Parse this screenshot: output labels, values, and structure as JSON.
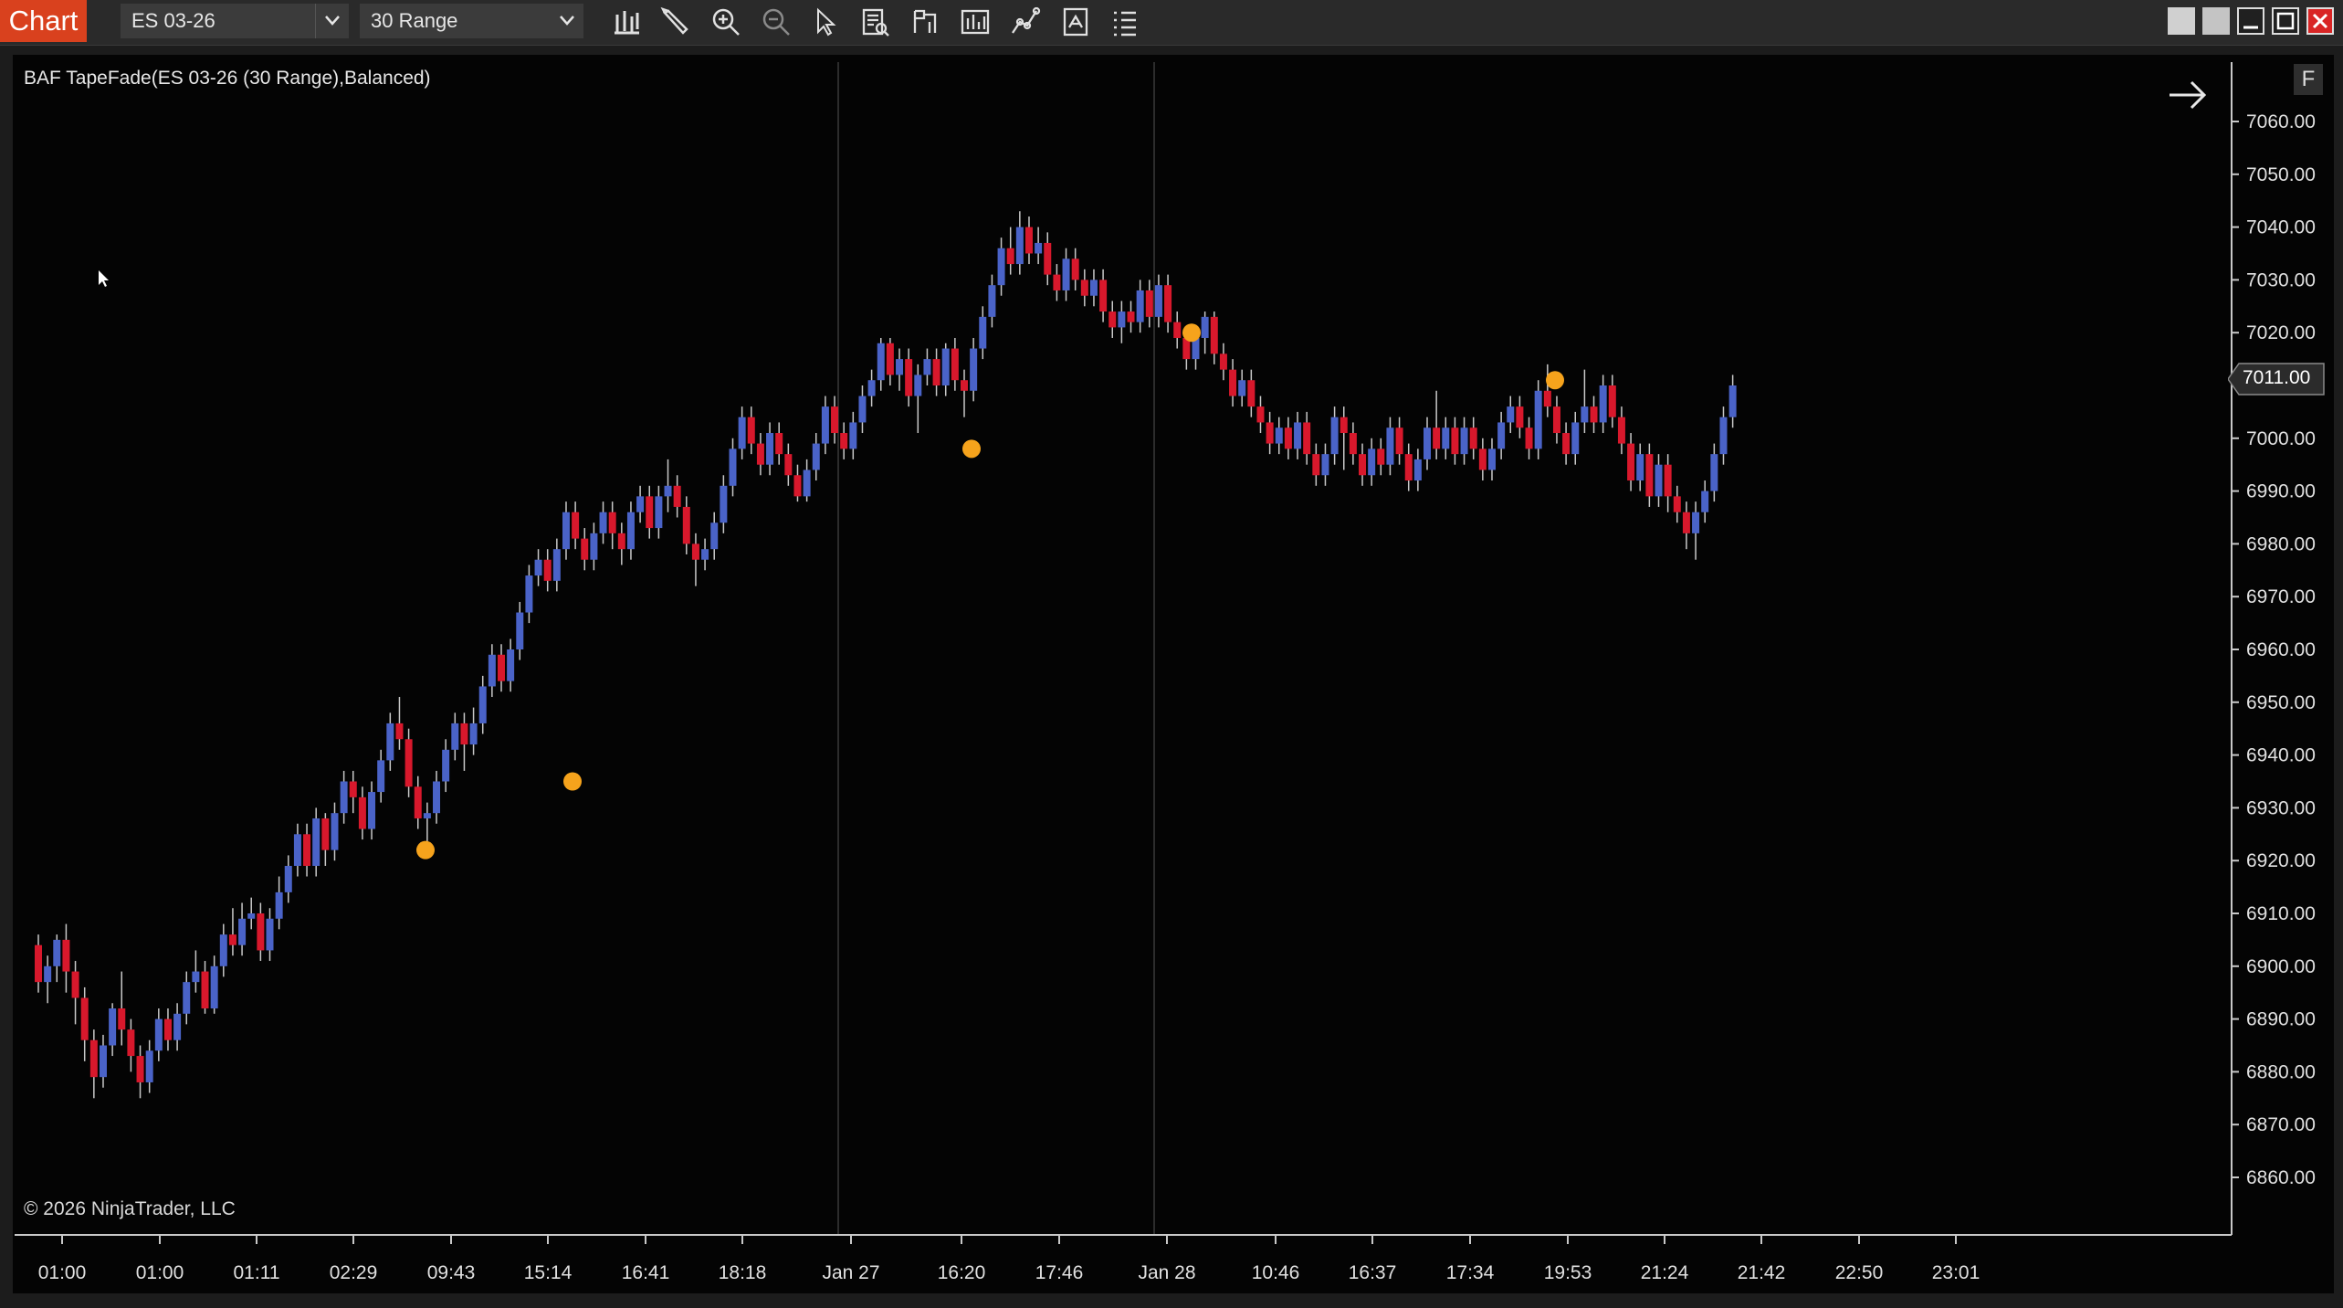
{
  "toolbar": {
    "app_tab": "Chart",
    "instrument": "ES 03-26",
    "interval": "30 Range",
    "tools": [
      {
        "name": "bar-type-icon"
      },
      {
        "name": "drawing-tools-icon"
      },
      {
        "name": "zoom-in-icon"
      },
      {
        "name": "zoom-out-icon"
      },
      {
        "name": "cursor-icon"
      },
      {
        "name": "data-box-icon"
      },
      {
        "name": "chart-trader-icon"
      },
      {
        "name": "indicators-icon"
      },
      {
        "name": "strategies-icon"
      },
      {
        "name": "properties-icon"
      },
      {
        "name": "list-icon"
      }
    ]
  },
  "chart": {
    "legend_title": "BAF TapeFade(ES 03-26 (30 Range),Balanced)",
    "copyright": "© 2026 NinjaTrader, LLC",
    "f_button": "F",
    "current_price_label": "7011.00",
    "colors": {
      "up": "#4a63c8",
      "down": "#d8182c",
      "signal": "#f6a31c",
      "background": "#040404"
    }
  },
  "chart_data": {
    "type": "candlestick",
    "title": "BAF TapeFade(ES 03-26 (30 Range),Balanced)",
    "y_ticks": [
      "7060.00",
      "7050.00",
      "7040.00",
      "7030.00",
      "7020.00",
      "7010.00",
      "7000.00",
      "6990.00",
      "6980.00",
      "6970.00",
      "6960.00",
      "6950.00",
      "6940.00",
      "6930.00",
      "6920.00",
      "6910.00",
      "6900.00",
      "6890.00",
      "6880.00",
      "6870.00",
      "6860.00"
    ],
    "x_ticks": [
      "01:00",
      "01:00",
      "01:11",
      "02:29",
      "09:43",
      "15:14",
      "16:41",
      "18:18",
      "Jan 27",
      "16:20",
      "17:46",
      "Jan 28",
      "10:46",
      "16:37",
      "17:34",
      "19:53",
      "21:24",
      "21:42",
      "22:50",
      "23:01"
    ],
    "ylim": [
      6855,
      7066
    ],
    "last_price": 7011.0,
    "bars": [
      [
        6904,
        6897,
        6906,
        6895
      ],
      [
        6897,
        6900,
        6902,
        6893
      ],
      [
        6900,
        6905,
        6906,
        6897
      ],
      [
        6905,
        6899,
        6908,
        6895
      ],
      [
        6899,
        6894,
        6901,
        6889
      ],
      [
        6894,
        6886,
        6896,
        6882
      ],
      [
        6886,
        6879,
        6888,
        6875
      ],
      [
        6879,
        6885,
        6887,
        6877
      ],
      [
        6885,
        6892,
        6893,
        6883
      ],
      [
        6892,
        6888,
        6899,
        6885
      ],
      [
        6888,
        6883,
        6890,
        6880
      ],
      [
        6883,
        6878,
        6885,
        6875
      ],
      [
        6878,
        6884,
        6886,
        6876
      ],
      [
        6884,
        6890,
        6892,
        6882
      ],
      [
        6890,
        6886,
        6892,
        6884
      ],
      [
        6886,
        6891,
        6893,
        6884
      ],
      [
        6891,
        6897,
        6899,
        6889
      ],
      [
        6897,
        6899,
        6903,
        6895
      ],
      [
        6899,
        6892,
        6901,
        6891
      ],
      [
        6892,
        6900,
        6902,
        6891
      ],
      [
        6900,
        6906,
        6908,
        6898
      ],
      [
        6906,
        6904,
        6911,
        6902
      ],
      [
        6904,
        6909,
        6912,
        6902
      ],
      [
        6909,
        6910,
        6913,
        6907
      ],
      [
        6910,
        6903,
        6912,
        6901
      ],
      [
        6903,
        6909,
        6911,
        6901
      ],
      [
        6909,
        6914,
        6917,
        6907
      ],
      [
        6914,
        6919,
        6921,
        6912
      ],
      [
        6919,
        6925,
        6927,
        6917
      ],
      [
        6925,
        6919,
        6927,
        6917
      ],
      [
        6919,
        6928,
        6930,
        6917
      ],
      [
        6928,
        6922,
        6929,
        6919
      ],
      [
        6922,
        6929,
        6931,
        6920
      ],
      [
        6929,
        6935,
        6937,
        6927
      ],
      [
        6935,
        6932,
        6937,
        6929
      ],
      [
        6932,
        6926,
        6934,
        6924
      ],
      [
        6926,
        6933,
        6935,
        6924
      ],
      [
        6933,
        6939,
        6941,
        6931
      ],
      [
        6939,
        6946,
        6948,
        6937
      ],
      [
        6946,
        6943,
        6951,
        6941
      ],
      [
        6943,
        6934,
        6945,
        6932
      ],
      [
        6934,
        6928,
        6936,
        6926
      ],
      [
        6928,
        6929,
        6931,
        6922
      ],
      [
        6929,
        6935,
        6937,
        6927
      ],
      [
        6935,
        6941,
        6943,
        6933
      ],
      [
        6941,
        6946,
        6948,
        6939
      ],
      [
        6946,
        6942,
        6948,
        6937
      ],
      [
        6942,
        6946,
        6949,
        6940
      ],
      [
        6946,
        6953,
        6955,
        6944
      ],
      [
        6953,
        6959,
        6961,
        6951
      ],
      [
        6959,
        6954,
        6961,
        6952
      ],
      [
        6954,
        6960,
        6962,
        6952
      ],
      [
        6960,
        6967,
        6969,
        6958
      ],
      [
        6967,
        6974,
        6976,
        6965
      ],
      [
        6974,
        6977,
        6979,
        6972
      ],
      [
        6977,
        6973,
        6979,
        6971
      ],
      [
        6973,
        6979,
        6981,
        6971
      ],
      [
        6979,
        6986,
        6988,
        6977
      ],
      [
        6986,
        6981,
        6988,
        6979
      ],
      [
        6981,
        6977,
        6983,
        6975
      ],
      [
        6977,
        6982,
        6984,
        6975
      ],
      [
        6982,
        6986,
        6988,
        6980
      ],
      [
        6986,
        6982,
        6988,
        6979
      ],
      [
        6982,
        6979,
        6984,
        6976
      ],
      [
        6979,
        6986,
        6988,
        6977
      ],
      [
        6986,
        6989,
        6991,
        6984
      ],
      [
        6989,
        6983,
        6991,
        6981
      ],
      [
        6983,
        6989,
        6991,
        6981
      ],
      [
        6989,
        6991,
        6996,
        6986
      ],
      [
        6991,
        6987,
        6993,
        6985
      ],
      [
        6987,
        6980,
        6989,
        6978
      ],
      [
        6980,
        6977,
        6982,
        6972
      ],
      [
        6977,
        6979,
        6981,
        6975
      ],
      [
        6979,
        6984,
        6986,
        6977
      ],
      [
        6984,
        6991,
        6993,
        6982
      ],
      [
        6991,
        6998,
        7000,
        6989
      ],
      [
        6998,
        7004,
        7006,
        6996
      ],
      [
        7004,
        6999,
        7006,
        6997
      ],
      [
        6999,
        6995,
        7001,
        6993
      ],
      [
        6995,
        7001,
        7003,
        6993
      ],
      [
        7001,
        6997,
        7003,
        6995
      ],
      [
        6997,
        6993,
        6999,
        6991
      ],
      [
        6993,
        6989,
        6995,
        6988
      ],
      [
        6989,
        6994,
        6996,
        6988
      ],
      [
        6994,
        6999,
        7001,
        6992
      ],
      [
        6999,
        7006,
        7008,
        6997
      ],
      [
        7006,
        7001,
        7008,
        6999
      ],
      [
        7001,
        6998,
        7003,
        6996
      ],
      [
        6998,
        7003,
        7005,
        6996
      ],
      [
        7003,
        7008,
        7010,
        7001
      ],
      [
        7008,
        7011,
        7013,
        7006
      ],
      [
        7011,
        7018,
        7019,
        7009
      ],
      [
        7018,
        7012,
        7019,
        7010
      ],
      [
        7012,
        7015,
        7017,
        7009
      ],
      [
        7015,
        7008,
        7017,
        7006
      ],
      [
        7008,
        7012,
        7014,
        7001
      ],
      [
        7012,
        7015,
        7017,
        7010
      ],
      [
        7015,
        7010,
        7017,
        7008
      ],
      [
        7010,
        7017,
        7018,
        7008
      ],
      [
        7017,
        7011,
        7019,
        7009
      ],
      [
        7011,
        7009,
        7013,
        7004
      ],
      [
        7009,
        7017,
        7019,
        7007
      ],
      [
        7017,
        7023,
        7025,
        7015
      ],
      [
        7023,
        7029,
        7031,
        7021
      ],
      [
        7029,
        7036,
        7038,
        7027
      ],
      [
        7036,
        7033,
        7040,
        7031
      ],
      [
        7033,
        7040,
        7043,
        7031
      ],
      [
        7040,
        7035,
        7042,
        7033
      ],
      [
        7035,
        7037,
        7040,
        7033
      ],
      [
        7037,
        7031,
        7039,
        7029
      ],
      [
        7031,
        7028,
        7033,
        7026
      ],
      [
        7028,
        7034,
        7036,
        7026
      ],
      [
        7034,
        7030,
        7036,
        7028
      ],
      [
        7030,
        7027,
        7032,
        7025
      ],
      [
        7027,
        7030,
        7032,
        7025
      ],
      [
        7030,
        7024,
        7032,
        7022
      ],
      [
        7024,
        7021,
        7026,
        7019
      ],
      [
        7021,
        7024,
        7026,
        7018
      ],
      [
        7024,
        7022,
        7026,
        7020
      ],
      [
        7022,
        7028,
        7030,
        7020
      ],
      [
        7028,
        7023,
        7030,
        7021
      ],
      [
        7023,
        7029,
        7031,
        7021
      ],
      [
        7029,
        7022,
        7031,
        7020
      ],
      [
        7022,
        7019,
        7024,
        7017
      ],
      [
        7019,
        7015,
        7021,
        7013
      ],
      [
        7015,
        7019,
        7021,
        7013
      ],
      [
        7019,
        7023,
        7024,
        7016
      ],
      [
        7023,
        7016,
        7024,
        7014
      ],
      [
        7016,
        7013,
        7018,
        7011
      ],
      [
        7013,
        7008,
        7015,
        7006
      ],
      [
        7008,
        7011,
        7013,
        7006
      ],
      [
        7011,
        7006,
        7013,
        7004
      ],
      [
        7006,
        7003,
        7008,
        7001
      ],
      [
        7003,
        6999,
        7005,
        6997
      ],
      [
        6999,
        7002,
        7004,
        6997
      ],
      [
        7002,
        6998,
        7004,
        6996
      ],
      [
        6998,
        7003,
        7005,
        6996
      ],
      [
        7003,
        6997,
        7005,
        6995
      ],
      [
        6997,
        6993,
        6999,
        6991
      ],
      [
        6993,
        6997,
        6999,
        6991
      ],
      [
        6997,
        7004,
        7006,
        6995
      ],
      [
        7004,
        7001,
        7006,
        6994
      ],
      [
        7001,
        6997,
        7003,
        6995
      ],
      [
        6997,
        6993,
        6999,
        6991
      ],
      [
        6993,
        6998,
        7000,
        6991
      ],
      [
        6998,
        6995,
        7000,
        6993
      ],
      [
        6995,
        7002,
        7004,
        6993
      ],
      [
        7002,
        6997,
        7004,
        6995
      ],
      [
        6997,
        6992,
        6999,
        6990
      ],
      [
        6992,
        6996,
        6998,
        6990
      ],
      [
        6996,
        7002,
        7004,
        6994
      ],
      [
        7002,
        6998,
        7009,
        6996
      ],
      [
        6998,
        7002,
        7004,
        6996
      ],
      [
        7002,
        6997,
        7004,
        6995
      ],
      [
        6997,
        7002,
        7004,
        6995
      ],
      [
        7002,
        6998,
        7004,
        6996
      ],
      [
        6998,
        6994,
        7000,
        6992
      ],
      [
        6994,
        6998,
        7000,
        6992
      ],
      [
        6998,
        7003,
        7005,
        6996
      ],
      [
        7003,
        7006,
        7008,
        7001
      ],
      [
        7006,
        7002,
        7008,
        7000
      ],
      [
        7002,
        6998,
        7004,
        6996
      ],
      [
        6998,
        7009,
        7011,
        6996
      ],
      [
        7009,
        7006,
        7014,
        7004
      ],
      [
        7006,
        7001,
        7008,
        6999
      ],
      [
        7001,
        6997,
        7003,
        6995
      ],
      [
        6997,
        7003,
        7005,
        6995
      ],
      [
        7003,
        7006,
        7013,
        7001
      ],
      [
        7006,
        7003,
        7008,
        7001
      ],
      [
        7003,
        7010,
        7012,
        7001
      ],
      [
        7010,
        7004,
        7012,
        7002
      ],
      [
        7004,
        6999,
        7006,
        6997
      ],
      [
        6999,
        6992,
        7001,
        6990
      ],
      [
        6992,
        6997,
        6999,
        6990
      ],
      [
        6997,
        6989,
        6999,
        6987
      ],
      [
        6989,
        6995,
        6997,
        6987
      ],
      [
        6995,
        6989,
        6997,
        6986
      ],
      [
        6989,
        6986,
        6991,
        6984
      ],
      [
        6986,
        6982,
        6988,
        6979
      ],
      [
        6982,
        6986,
        6988,
        6977
      ],
      [
        6986,
        6990,
        6992,
        6984
      ],
      [
        6990,
        6997,
        6999,
        6988
      ],
      [
        6997,
        7004,
        7006,
        6995
      ],
      [
        7004,
        7010,
        7012,
        7002
      ]
    ],
    "signals": [
      {
        "time": "09:43",
        "price": 6922
      },
      {
        "time": "15:14",
        "price": 6935
      },
      {
        "time": "16:20",
        "price": 6998
      },
      {
        "time": "Jan 28",
        "price": 7020
      },
      {
        "time": "19:53",
        "price": 7011
      }
    ]
  }
}
